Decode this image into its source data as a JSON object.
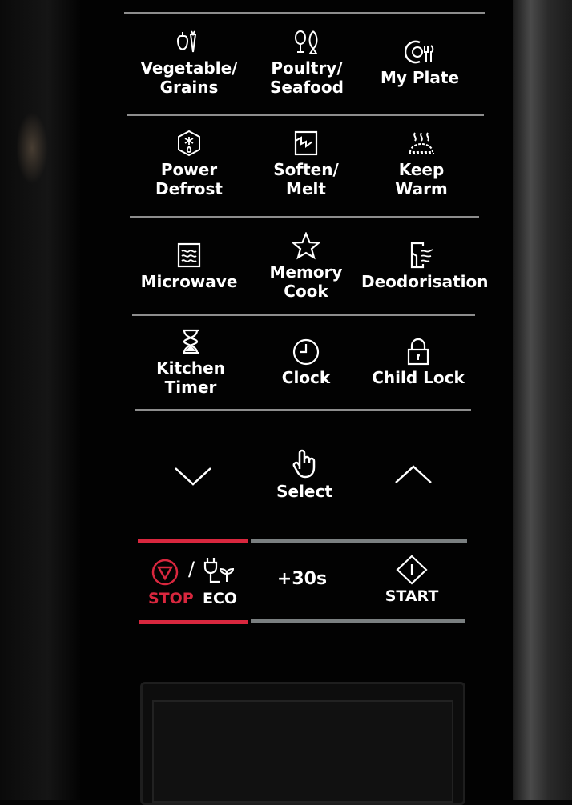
{
  "buttons": [
    {
      "label1": "Vegetable/",
      "label2": "Grains",
      "icon": "vegetable-icon"
    },
    {
      "label1": "Poultry/",
      "label2": "Seafood",
      "icon": "poultry-seafood-icon"
    },
    {
      "label1": "My Plate",
      "label2": "",
      "icon": "plate-icon"
    },
    {
      "label1": "Power",
      "label2": "Defrost",
      "icon": "defrost-icon"
    },
    {
      "label1": "Soften/",
      "label2": "Melt",
      "icon": "soften-icon"
    },
    {
      "label1": "Keep",
      "label2": "Warm",
      "icon": "steam-icon"
    },
    {
      "label1": "Microwave",
      "label2": "",
      "icon": "microwave-icon"
    },
    {
      "label1": "Memory",
      "label2": "Cook",
      "icon": "star-icon"
    },
    {
      "label1": "Deodorisation",
      "label2": "",
      "icon": "deodorise-icon"
    },
    {
      "label1": "Kitchen",
      "label2": "Timer",
      "icon": "hourglass-icon"
    },
    {
      "label1": "Clock",
      "label2": "",
      "icon": "clock-icon"
    },
    {
      "label1": "Child Lock",
      "label2": "",
      "icon": "lock-icon"
    }
  ],
  "nav": {
    "select": "Select",
    "down": "chevron-down-icon",
    "up": "chevron-up-icon"
  },
  "bottom": {
    "stop": "STOP",
    "slash": "/",
    "eco": "ECO",
    "plus30": "+30s",
    "start": "START"
  },
  "colors": {
    "stop_red": "#d8273e",
    "divider_gray": "#7a7f80"
  }
}
